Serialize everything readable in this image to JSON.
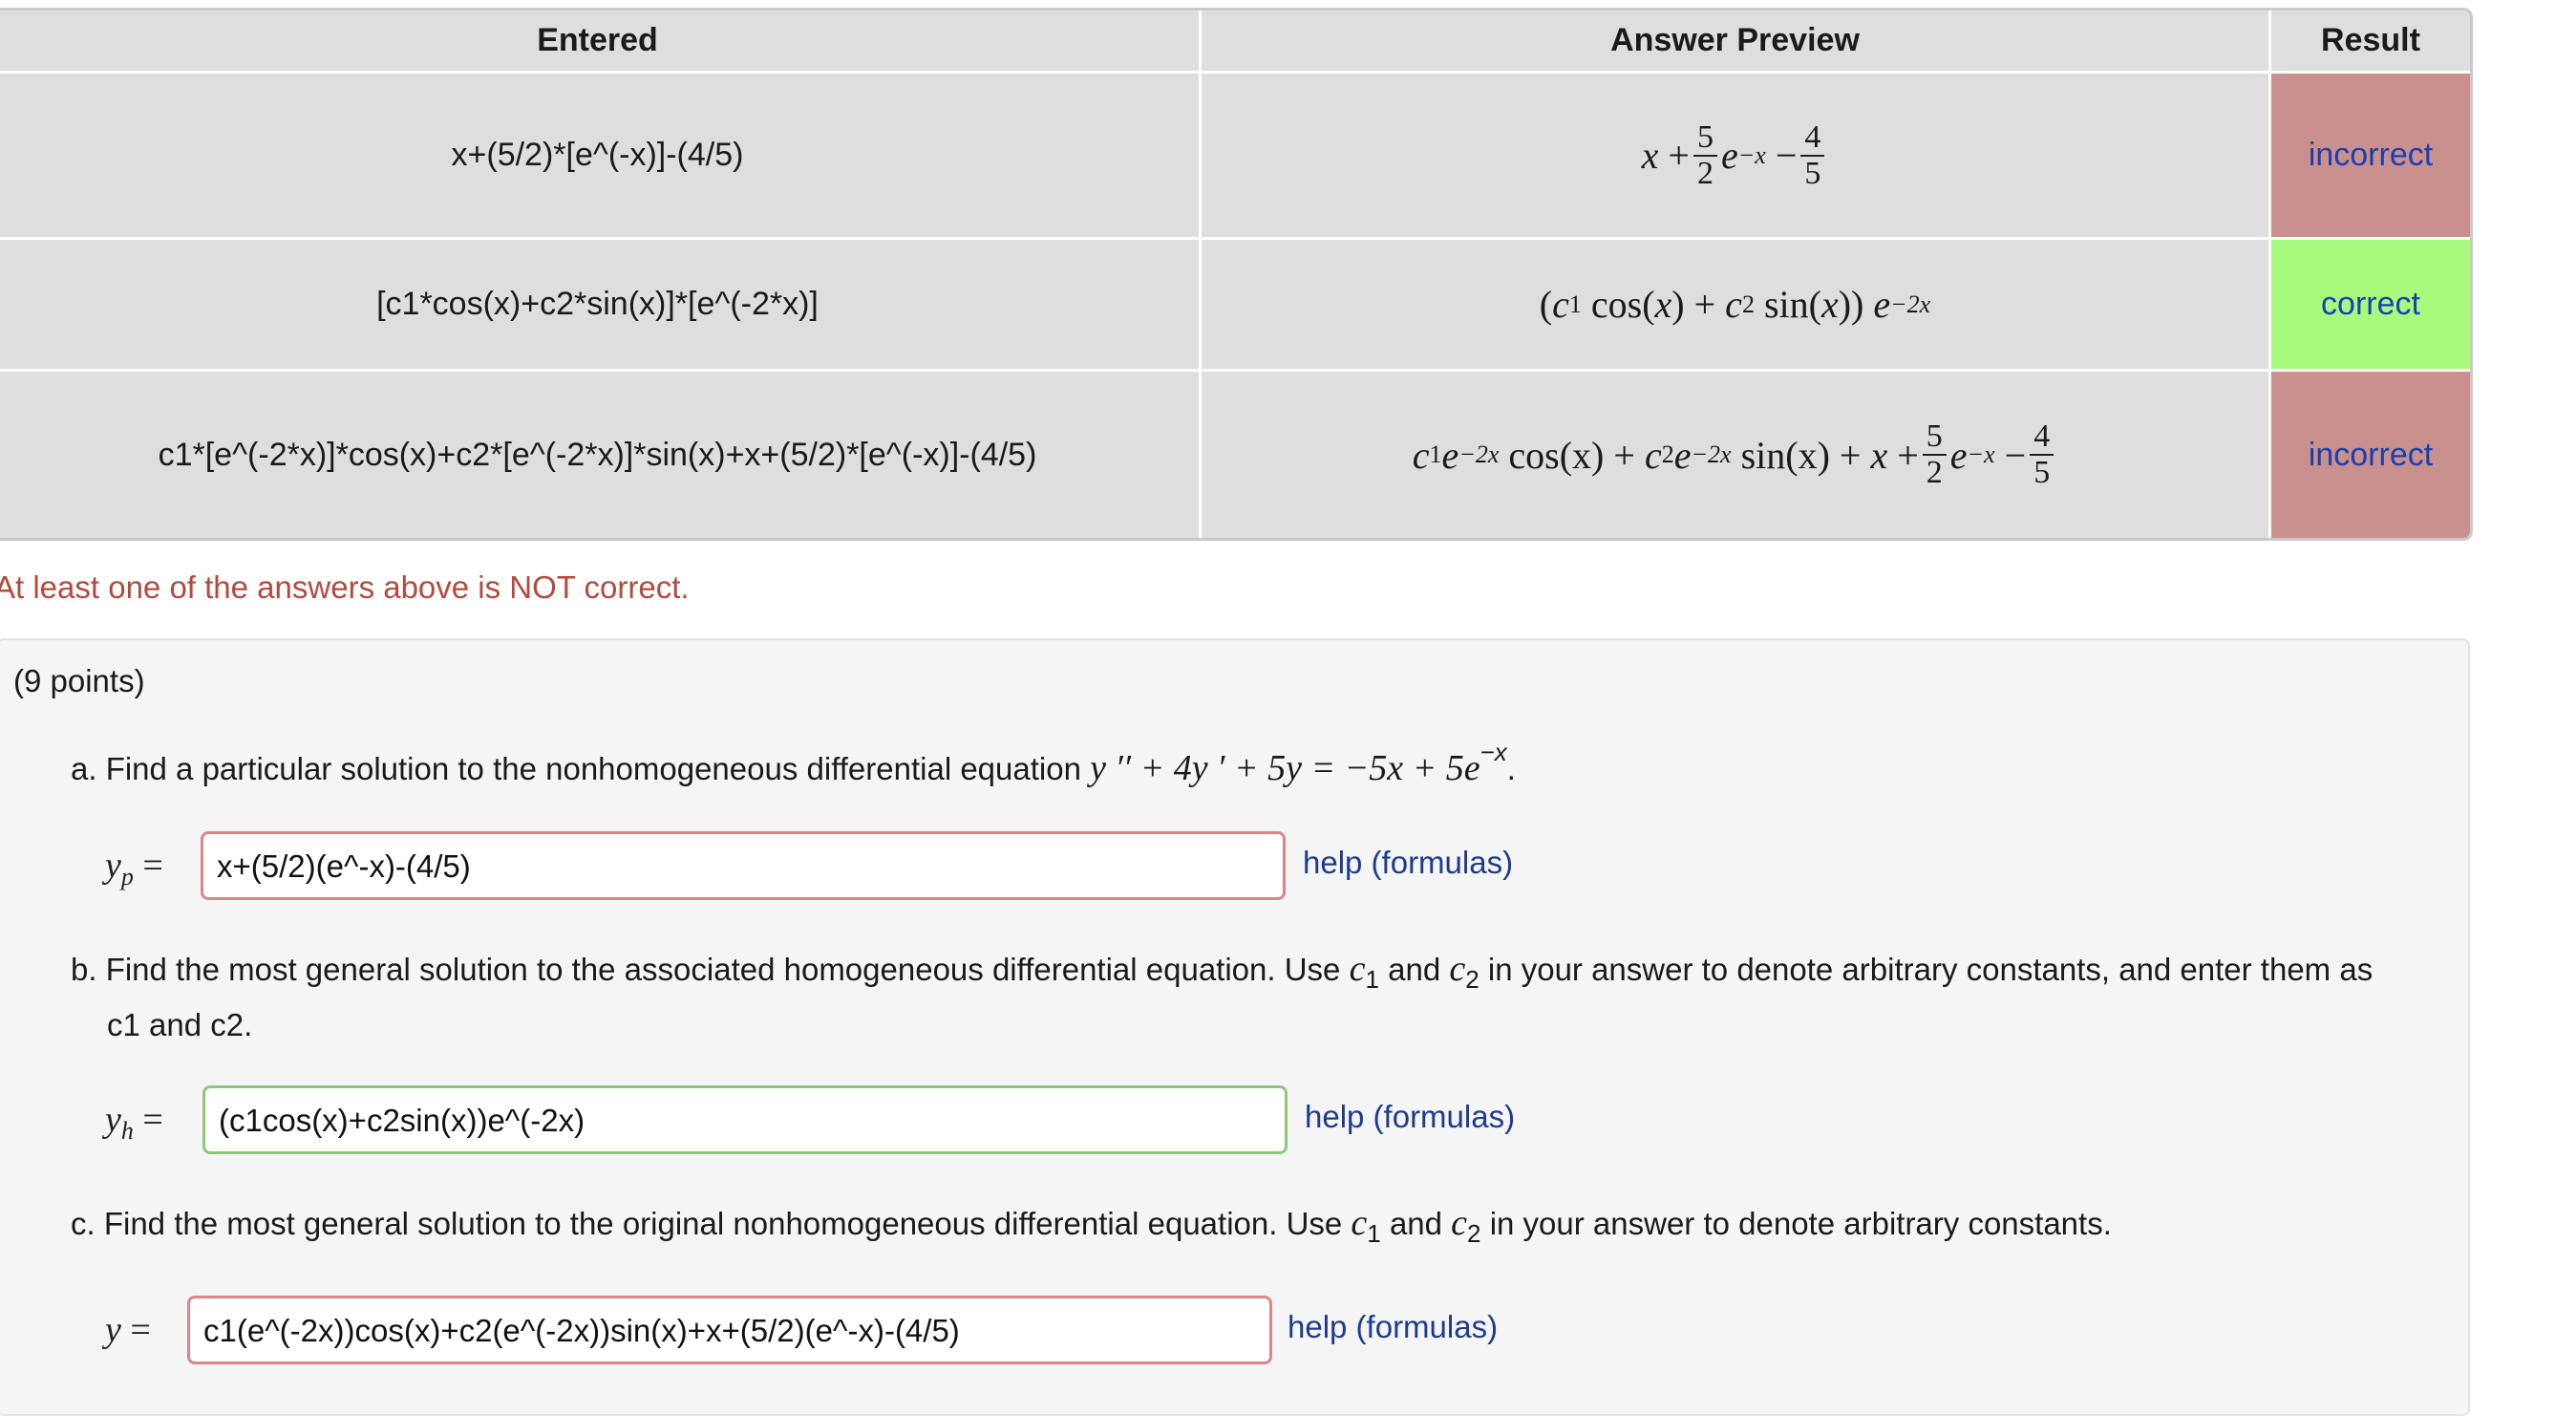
{
  "table": {
    "headers": {
      "entered": "Entered",
      "preview": "Answer Preview",
      "result": "Result"
    },
    "rows": [
      {
        "entered": "x+(5/2)*[e^(-x)]-(4/5)",
        "preview": {
          "x": "x",
          "plus": "+",
          "frac1_num": "5",
          "frac1_den": "2",
          "e": "e",
          "exp": "−x",
          "minus": "−",
          "frac2_num": "4",
          "frac2_den": "5"
        },
        "result": "incorrect",
        "result_color": "#c9908e"
      },
      {
        "entered": "[c1*cos(x)+c2*sin(x)]*[e^(-2*x)]",
        "preview": {
          "open": "(",
          "c": "c",
          "one": "1",
          "cos": "cos(",
          "x": "x",
          "close1": ")",
          "plus": "+",
          "c2": "c",
          "two": "2",
          "sin": "sin(",
          "x2": "x",
          "close2": "))",
          "e": "e",
          "exp": "−2x"
        },
        "result": "correct",
        "result_color": "#a6fb7c"
      },
      {
        "entered": "c1*[e^(-2*x)]*cos(x)+c2*[e^(-2*x)]*sin(x)+x+(5/2)*[e^(-x)]-(4/5)",
        "preview": {
          "c": "c",
          "one": "1",
          "e": "e",
          "exp1": "−2x",
          "cos": "cos(x)",
          "plus1": "+",
          "c2": "c",
          "two": "2",
          "e2": "e",
          "exp2": "−2x",
          "sin": "sin(x)",
          "plus2": "+",
          "x": "x",
          "plus3": "+",
          "frac1_num": "5",
          "frac1_den": "2",
          "e3": "e",
          "exp3": "−x",
          "minus": "−",
          "frac2_num": "4",
          "frac2_den": "5"
        },
        "result": "incorrect",
        "result_color": "#c9908e"
      }
    ]
  },
  "warning": "At least one of the answers above is NOT correct.",
  "problem": {
    "points": "(9 points)",
    "part_a": {
      "text": "a. Find a particular solution to the nonhomogeneous differential equation",
      "equation": "y ′′ + 4y ′ + 5y = −5x + 5e",
      "exp": "−x",
      "period": ".",
      "label_var": "y",
      "label_sub": "p",
      "label_eq": "=",
      "value": "x+(5/2)(e^-x)-(4/5)",
      "status": "incorrect",
      "help": "help (formulas)"
    },
    "part_b": {
      "text_pre": "b. Find the most general solution to the associated homogeneous differential equation. Use",
      "c1": "c",
      "c1_sub": "1",
      "and": "and",
      "c2": "c",
      "c2_sub": "2",
      "text_post": "in your answer to denote arbitrary constants, and enter them as",
      "text_line2": "c1 and c2.",
      "label_var": "y",
      "label_sub": "h",
      "label_eq": "=",
      "value": "(c1cos(x)+c2sin(x))e^(-2x)",
      "status": "correct",
      "help": "help (formulas)"
    },
    "part_c": {
      "text_pre": "c. Find the most general solution to the original nonhomogeneous differential equation. Use",
      "c1": "c",
      "c1_sub": "1",
      "and": "and",
      "c2": "c",
      "c2_sub": "2",
      "text_post": "in your answer to denote arbitrary constants.",
      "label_var": "y",
      "label_eq": "=",
      "value": "c1(e^(-2x))cos(x)+c2(e^(-2x))sin(x)+x+(5/2)(e^-x)-(4/5)",
      "status": "incorrect",
      "help": "help (formulas)"
    }
  }
}
